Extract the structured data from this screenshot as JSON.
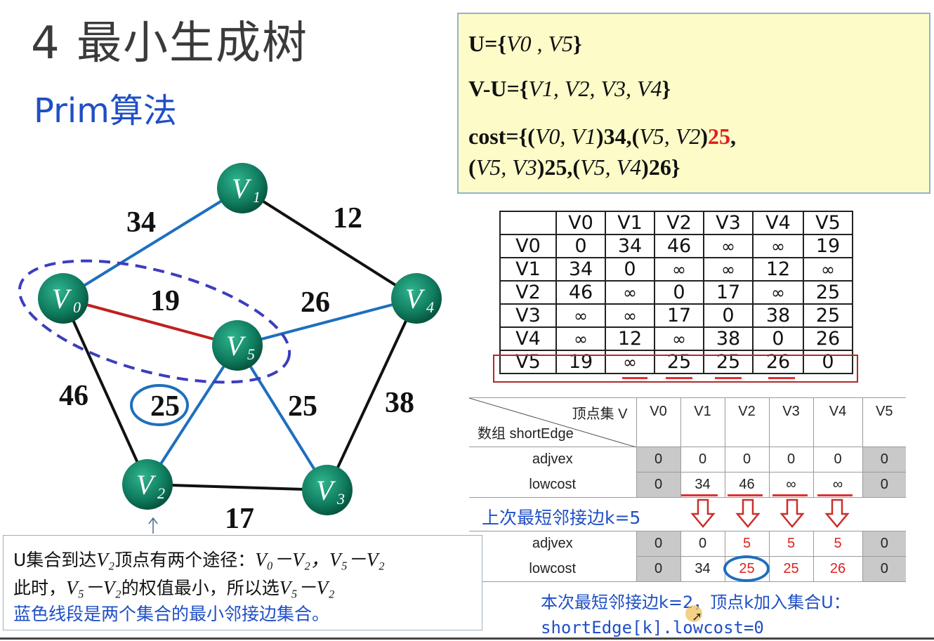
{
  "title": "4 最小生成树",
  "subtitle": "Prim算法",
  "sets": {
    "u_label": "U={",
    "u_items": "V0 , V5",
    "u_close": "}",
    "vu_label": "V-U={",
    "vu_items": "V1, V2, V3, V4",
    "vu_close": "}",
    "cost_line1_a": "cost={(",
    "cost_line1_e1": "V0, V1",
    "cost_line1_b": ")34,(",
    "cost_line1_e2": "V5, V2",
    "cost_line1_c": ")",
    "cost_line1_red": "25",
    "cost_line1_d": ",",
    "cost_line2_a": "(",
    "cost_line2_e1": "V5, V3",
    "cost_line2_b": ")25,(",
    "cost_line2_e2": "V5, V4",
    "cost_line2_c": ")26}"
  },
  "graph": {
    "nodes": [
      {
        "id": "V1",
        "label": "V",
        "sub": "1"
      },
      {
        "id": "V0",
        "label": "V",
        "sub": "0"
      },
      {
        "id": "V4",
        "label": "V",
        "sub": "4"
      },
      {
        "id": "V5",
        "label": "V",
        "sub": "5"
      },
      {
        "id": "V2",
        "label": "V",
        "sub": "2"
      },
      {
        "id": "V3",
        "label": "V",
        "sub": "3"
      }
    ],
    "edge_weights": {
      "v0_v1": "34",
      "v1_v4": "12",
      "v0_v5": "19",
      "v5_v4": "26",
      "v0_v2": "46",
      "v5_v2": "25",
      "v5_v3": "25",
      "v4_v3": "38",
      "v2_v3": "17"
    },
    "colors": {
      "tree_edge": "#e02020",
      "candidate_edge": "#1e6fbe",
      "other_edge": "#111111",
      "node": "#0f7a5e",
      "set_outline": "#3d3dbe"
    }
  },
  "adjacency": {
    "header": [
      "",
      "V0",
      "V1",
      "V2",
      "V3",
      "V4",
      "V5"
    ],
    "rows": [
      [
        "V0",
        "0",
        "34",
        "46",
        "∞",
        "∞",
        "19"
      ],
      [
        "V1",
        "34",
        "0",
        "∞",
        "∞",
        "12",
        "∞"
      ],
      [
        "V2",
        "46",
        "∞",
        "0",
        "17",
        "∞",
        "25"
      ],
      [
        "V3",
        "∞",
        "∞",
        "17",
        "0",
        "38",
        "25"
      ],
      [
        "V4",
        "∞",
        "12",
        "∞",
        "38",
        "0",
        "26"
      ],
      [
        "V5",
        "19",
        "∞",
        "25",
        "25",
        "26",
        "0"
      ]
    ]
  },
  "short_edge": {
    "corner_top": "顶点集 V",
    "corner_bottom": "数组 shortEdge",
    "cols": [
      "V0",
      "V1",
      "V2",
      "V3",
      "V4",
      "V5"
    ],
    "adjvex_label": "adjvex",
    "lowcost_label": "lowcost",
    "before_adjvex": [
      "0",
      "0",
      "0",
      "0",
      "0",
      "0"
    ],
    "before_lowcost": [
      "0",
      "34",
      "46",
      "∞",
      "∞",
      "0"
    ],
    "after_adjvex": [
      "0",
      "0",
      "5",
      "5",
      "5",
      "0"
    ],
    "after_lowcost": [
      "0",
      "34",
      "25",
      "25",
      "26",
      "0"
    ],
    "step_label": "上次最短邻接边k=5",
    "note_line1": "本次最短邻接边k=2，顶点k加入集合U：",
    "note_line2": "shortEdge[k].lowcost=0"
  },
  "explain": {
    "l1_a": "U集合到达",
    "l1_v": "V₂",
    "l1_b": "顶点有两个途径：",
    "l1_path": "V₀－V₂，V₅－V₂",
    "l2_a": "此时，",
    "l2_v": "V₅－V₂",
    "l2_b": "的权值最小，所以选",
    "l2_v2": "V₅－V₂",
    "l3": "蓝色线段是两个集合的最小邻接边集合。"
  }
}
